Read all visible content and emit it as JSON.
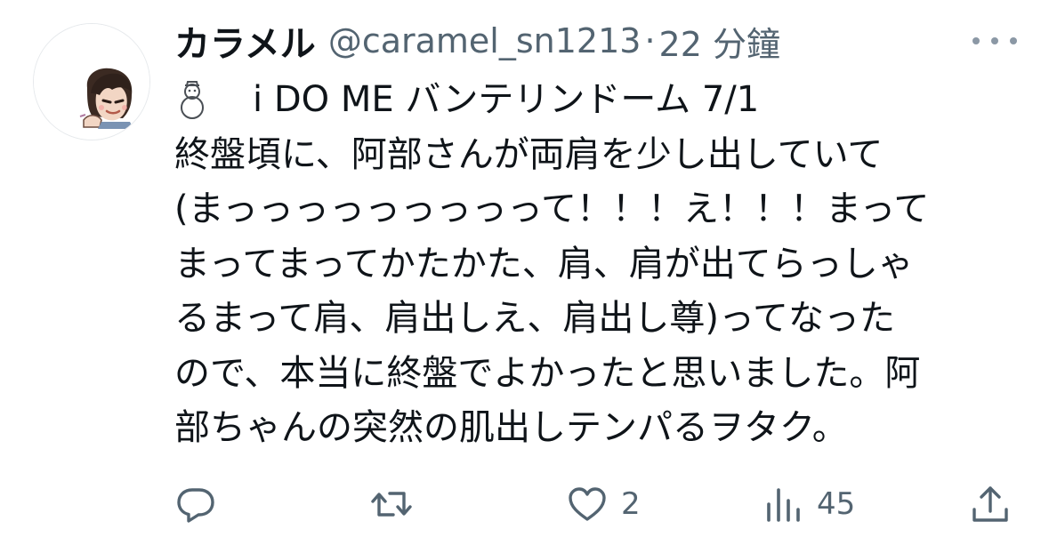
{
  "tweet": {
    "author": {
      "display_name": "カラメル",
      "handle": "@caramel_sn1213",
      "separator": "·",
      "time": "22 分鐘"
    },
    "icons": {
      "snowman": "snowman-icon",
      "more": "more-icon",
      "reply": "reply-icon",
      "retweet": "retweet-icon",
      "like": "heart-icon",
      "views": "views-icon",
      "share": "share-icon"
    },
    "lines": [
      "i DO ME バンテリンドーム 7/1",
      "終盤頃に、阿部さんが両肩を少し出していて",
      "(まっっっっっっっっって！！！え！！！まって",
      "まってまってかたかた、肩、肩が出てらっしゃ",
      "るまって肩、肩出しえ、肩出し尊)ってなった",
      "ので、本当に終盤でよかったと思いました。阿",
      "部ちゃんの突然の肌出しテンパるヲタク。"
    ],
    "stats": {
      "reply_count": "",
      "retweet_count": "",
      "like_count": "2",
      "view_count": "45"
    },
    "colors": {
      "text": "#0f1419",
      "secondary": "#536471",
      "more_dots": "#8b98a5"
    }
  }
}
